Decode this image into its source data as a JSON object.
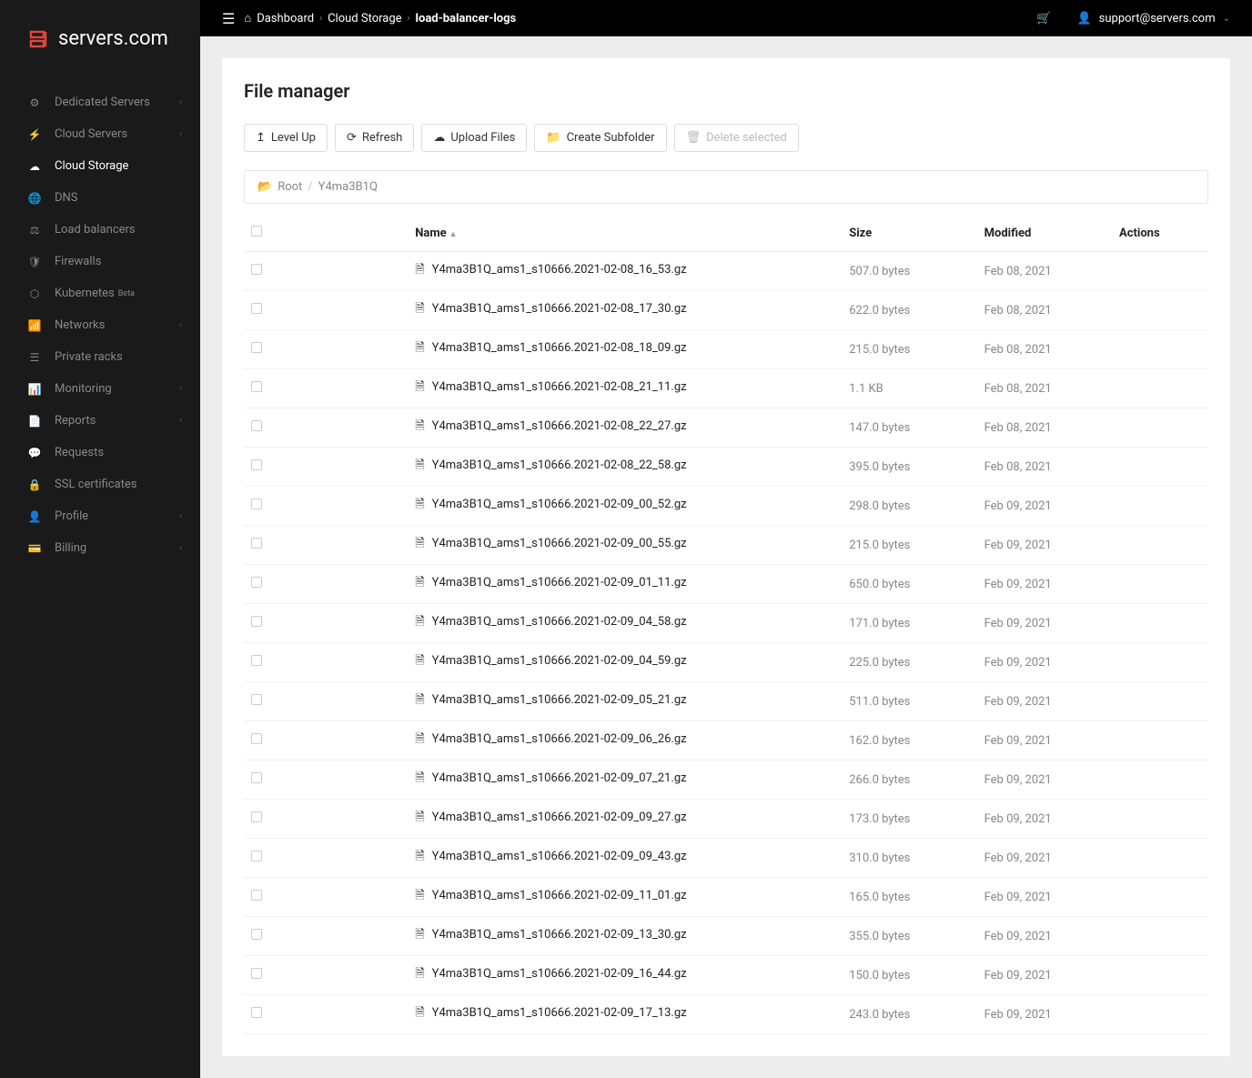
{
  "brand": "servers.com",
  "topbar": {
    "crumbs": [
      "Dashboard",
      "Cloud Storage",
      "load-balancer-logs"
    ],
    "user": "support@servers.com"
  },
  "sidebar": {
    "items": [
      {
        "label": "Dedicated Servers",
        "icon": "⚙",
        "chev": true
      },
      {
        "label": "Cloud Servers",
        "icon": "⚡",
        "chev": true
      },
      {
        "label": "Cloud Storage",
        "icon": "☁",
        "active": true
      },
      {
        "label": "DNS",
        "icon": "🌐"
      },
      {
        "label": "Load balancers",
        "icon": "⚖"
      },
      {
        "label": "Firewalls",
        "icon": "🛡"
      },
      {
        "label": "Kubernetes",
        "icon": "⬡",
        "badge": "Beta"
      },
      {
        "label": "Networks",
        "icon": "📶",
        "chev": true
      },
      {
        "label": "Private racks",
        "icon": "☰"
      },
      {
        "label": "Monitoring",
        "icon": "📊",
        "chev": true
      },
      {
        "label": "Reports",
        "icon": "📄",
        "chev": true
      },
      {
        "label": "Requests",
        "icon": "💬"
      },
      {
        "label": "SSL certificates",
        "icon": "🔒"
      },
      {
        "label": "Profile",
        "icon": "👤",
        "chev": true
      },
      {
        "label": "Billing",
        "icon": "💳",
        "chev": true
      }
    ]
  },
  "page": {
    "title": "File manager",
    "buttons": {
      "level_up": "Level Up",
      "refresh": "Refresh",
      "upload": "Upload Files",
      "create_subfolder": "Create Subfolder",
      "delete_selected": "Delete selected"
    },
    "path": {
      "root": "Root",
      "current": "Y4ma3B1Q"
    },
    "columns": {
      "name": "Name",
      "size": "Size",
      "modified": "Modified",
      "actions": "Actions"
    },
    "files": [
      {
        "name": "Y4ma3B1Q_ams1_s10666.2021-02-08_16_53.gz",
        "size": "507.0 bytes",
        "modified": "Feb 08, 2021"
      },
      {
        "name": "Y4ma3B1Q_ams1_s10666.2021-02-08_17_30.gz",
        "size": "622.0 bytes",
        "modified": "Feb 08, 2021"
      },
      {
        "name": "Y4ma3B1Q_ams1_s10666.2021-02-08_18_09.gz",
        "size": "215.0 bytes",
        "modified": "Feb 08, 2021"
      },
      {
        "name": "Y4ma3B1Q_ams1_s10666.2021-02-08_21_11.gz",
        "size": "1.1 KB",
        "modified": "Feb 08, 2021"
      },
      {
        "name": "Y4ma3B1Q_ams1_s10666.2021-02-08_22_27.gz",
        "size": "147.0 bytes",
        "modified": "Feb 08, 2021"
      },
      {
        "name": "Y4ma3B1Q_ams1_s10666.2021-02-08_22_58.gz",
        "size": "395.0 bytes",
        "modified": "Feb 08, 2021"
      },
      {
        "name": "Y4ma3B1Q_ams1_s10666.2021-02-09_00_52.gz",
        "size": "298.0 bytes",
        "modified": "Feb 09, 2021"
      },
      {
        "name": "Y4ma3B1Q_ams1_s10666.2021-02-09_00_55.gz",
        "size": "215.0 bytes",
        "modified": "Feb 09, 2021"
      },
      {
        "name": "Y4ma3B1Q_ams1_s10666.2021-02-09_01_11.gz",
        "size": "650.0 bytes",
        "modified": "Feb 09, 2021"
      },
      {
        "name": "Y4ma3B1Q_ams1_s10666.2021-02-09_04_58.gz",
        "size": "171.0 bytes",
        "modified": "Feb 09, 2021"
      },
      {
        "name": "Y4ma3B1Q_ams1_s10666.2021-02-09_04_59.gz",
        "size": "225.0 bytes",
        "modified": "Feb 09, 2021"
      },
      {
        "name": "Y4ma3B1Q_ams1_s10666.2021-02-09_05_21.gz",
        "size": "511.0 bytes",
        "modified": "Feb 09, 2021"
      },
      {
        "name": "Y4ma3B1Q_ams1_s10666.2021-02-09_06_26.gz",
        "size": "162.0 bytes",
        "modified": "Feb 09, 2021"
      },
      {
        "name": "Y4ma3B1Q_ams1_s10666.2021-02-09_07_21.gz",
        "size": "266.0 bytes",
        "modified": "Feb 09, 2021"
      },
      {
        "name": "Y4ma3B1Q_ams1_s10666.2021-02-09_09_27.gz",
        "size": "173.0 bytes",
        "modified": "Feb 09, 2021"
      },
      {
        "name": "Y4ma3B1Q_ams1_s10666.2021-02-09_09_43.gz",
        "size": "310.0 bytes",
        "modified": "Feb 09, 2021"
      },
      {
        "name": "Y4ma3B1Q_ams1_s10666.2021-02-09_11_01.gz",
        "size": "165.0 bytes",
        "modified": "Feb 09, 2021"
      },
      {
        "name": "Y4ma3B1Q_ams1_s10666.2021-02-09_13_30.gz",
        "size": "355.0 bytes",
        "modified": "Feb 09, 2021"
      },
      {
        "name": "Y4ma3B1Q_ams1_s10666.2021-02-09_16_44.gz",
        "size": "150.0 bytes",
        "modified": "Feb 09, 2021"
      },
      {
        "name": "Y4ma3B1Q_ams1_s10666.2021-02-09_17_13.gz",
        "size": "243.0 bytes",
        "modified": "Feb 09, 2021"
      }
    ]
  }
}
